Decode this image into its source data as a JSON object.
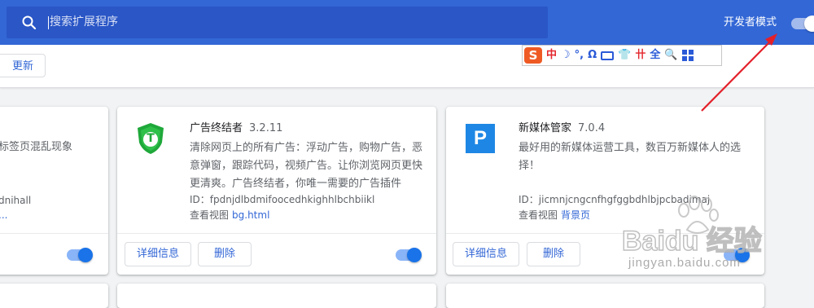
{
  "header": {
    "search_placeholder": "搜索扩展程序",
    "developer_mode_label": "开发者模式",
    "developer_mode_on": true
  },
  "toolbar": {
    "update_label": "更新"
  },
  "ime_bar": {
    "logo": "S",
    "items": [
      "中",
      "☽",
      "°,",
      "Ω",
      "⌨",
      "👕",
      "卄",
      "全",
      "🔍",
      "grid"
    ]
  },
  "cards": {
    "left_partial": {
      "desc": "标签页混乱现象",
      "id_fragment": "dnihall",
      "views_fragment": "..."
    },
    "ad_terminator": {
      "name": "广告终结者",
      "version": "3.2.11",
      "icon_letter": "T",
      "desc_lines": [
        "清除网页上的所有广告：浮动广告，购物广告，恶",
        "意弹窗，跟踪代码，视频广告。让你浏览网页更快",
        "更清爽。广告终结者，你唯一需要的广告插件"
      ],
      "id": "ID：fpdnjdlbdmifoocedhkighhlbchbiikl",
      "views_label": "查看视图",
      "views_link": "bg.html",
      "details_label": "详细信息",
      "remove_label": "删除",
      "enabled": true
    },
    "new_media": {
      "name": "新媒体管家",
      "version": "7.0.4",
      "icon_letter": "P",
      "desc_lines": [
        "最好用的新媒体运营工具，数百万新媒体人的选",
        "择！"
      ],
      "id": "ID：jicmnjcngcnfhgfggbdhlbjpcbadimaj",
      "views_label": "查看视图",
      "views_link": "背景页",
      "details_label": "详细信息",
      "remove_label": "删除",
      "enabled": true
    }
  },
  "watermark": {
    "brand": "Baidu 经验",
    "url": "jingyan.baidu.com"
  },
  "colors": {
    "header_bg": "#3367d6",
    "accent": "#1a73e8",
    "annotation_arrow": "#e3202a"
  }
}
